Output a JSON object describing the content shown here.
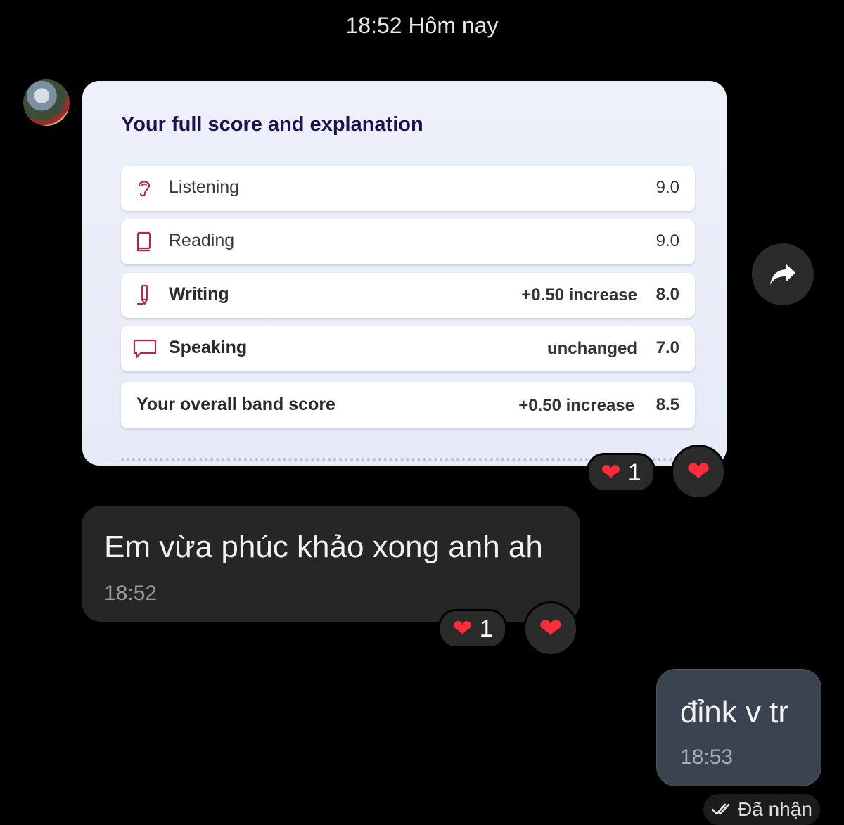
{
  "header": {
    "date_label": "18:52 Hôm nay"
  },
  "score_card": {
    "title": "Your full score and explanation",
    "rows": [
      {
        "icon": "ear-icon",
        "label": "Listening",
        "change": "",
        "score": "9.0"
      },
      {
        "icon": "book-icon",
        "label": "Reading",
        "change": "",
        "score": "9.0"
      },
      {
        "icon": "pen-icon",
        "label": "Writing",
        "change": "+0.50 increase",
        "score": "8.0"
      },
      {
        "icon": "speech-bubble-icon",
        "label": "Speaking",
        "change": "unchanged",
        "score": "7.0"
      }
    ],
    "overall": {
      "label": "Your overall band score",
      "change": "+0.50 increase",
      "score": "8.5"
    },
    "reaction": {
      "icon": "heart-icon",
      "count": "1"
    }
  },
  "incoming_message": {
    "text": "Em vừa phúc khảo xong anh ah",
    "time": "18:52",
    "reaction": {
      "icon": "heart-icon",
      "count": "1"
    }
  },
  "outgoing_message": {
    "text": "đỉnk v tr",
    "time": "18:53",
    "status": "Đã nhận",
    "status_icon": "double-check-icon"
  },
  "icons": {
    "forward": "forward-arrow-icon",
    "add_reaction": "heart-icon"
  },
  "colors": {
    "heart": "#ff2d3a",
    "card_title": "#21104e",
    "outgoing_bubble": "#3a4350",
    "incoming_bubble": "#262626"
  }
}
